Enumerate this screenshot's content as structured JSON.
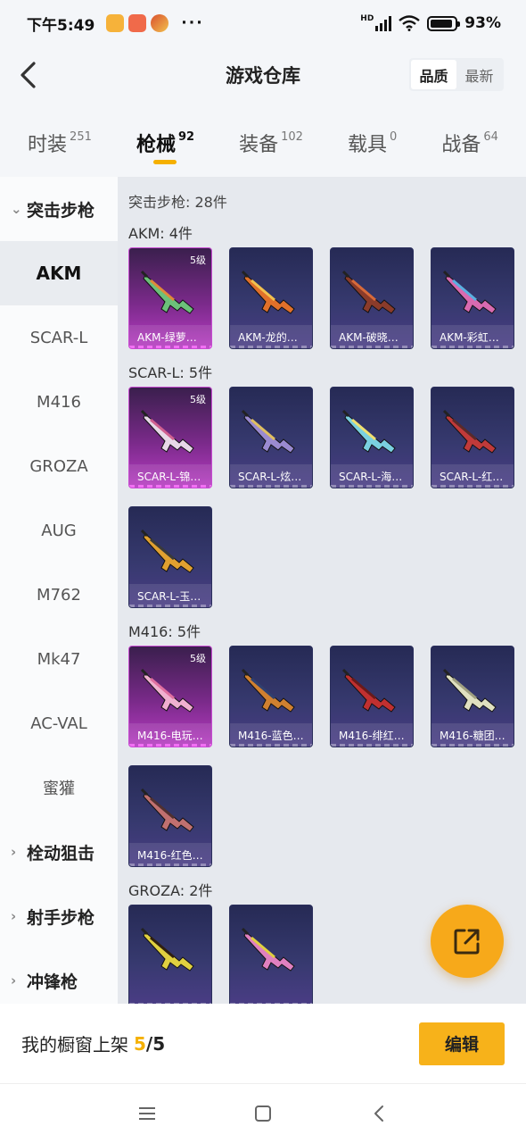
{
  "status_bar": {
    "time": "下午5:49",
    "hd": "HD",
    "battery": "93%",
    "more": "···"
  },
  "header": {
    "title": "游戏仓库",
    "sort_options": [
      "品质",
      "最新"
    ],
    "sort_selected": "品质"
  },
  "tabs": [
    {
      "label": "时装",
      "count": "251"
    },
    {
      "label": "枪械",
      "count": "92",
      "active": true
    },
    {
      "label": "装备",
      "count": "102"
    },
    {
      "label": "载具",
      "count": "0"
    },
    {
      "label": "战备",
      "count": "64"
    }
  ],
  "sidebar": {
    "groups": [
      {
        "label": "突击步枪",
        "expanded": true,
        "items": [
          "AKM",
          "SCAR-L",
          "M416",
          "GROZA",
          "AUG",
          "M762",
          "Mk47",
          "AC-VAL",
          "蜜獾"
        ]
      },
      {
        "label": "栓动狙击",
        "expanded": false
      },
      {
        "label": "射手步枪",
        "expanded": false
      },
      {
        "label": "冲锋枪",
        "expanded": false
      }
    ],
    "selected": "AKM"
  },
  "content": {
    "total": "突击步枪: 28件",
    "sections": [
      {
        "title": "AKM: 4件",
        "items": [
          {
            "name": "AKM-绿萝…",
            "level": "5级",
            "rarity": "epic"
          },
          {
            "name": "AKM-龙的…",
            "rarity": "normal"
          },
          {
            "name": "AKM-破晓…",
            "rarity": "normal"
          },
          {
            "name": "AKM-彩虹…",
            "rarity": "normal"
          }
        ]
      },
      {
        "title": "SCAR-L: 5件",
        "items": [
          {
            "name": "SCAR-L-锦…",
            "level": "5级",
            "rarity": "epic"
          },
          {
            "name": "SCAR-L-炫…",
            "rarity": "normal"
          },
          {
            "name": "SCAR-L-海…",
            "rarity": "normal"
          },
          {
            "name": "SCAR-L-红…",
            "rarity": "normal"
          },
          {
            "name": "SCAR-L-玉…",
            "rarity": "normal"
          }
        ]
      },
      {
        "title": "M416: 5件",
        "items": [
          {
            "name": "M416-电玩…",
            "level": "5级",
            "rarity": "epic"
          },
          {
            "name": "M416-蓝色…",
            "rarity": "normal"
          },
          {
            "name": "M416-绯红…",
            "rarity": "normal"
          },
          {
            "name": "M416-糖团…",
            "rarity": "normal"
          },
          {
            "name": "M416-红色…",
            "rarity": "normal"
          }
        ]
      },
      {
        "title": "GROZA: 2件",
        "items": [
          {
            "name": "",
            "rarity": "normal"
          },
          {
            "name": "",
            "rarity": "normal"
          }
        ]
      }
    ]
  },
  "showcase": {
    "label": "我的橱窗上架",
    "used": "5",
    "separator": "/",
    "total": "5",
    "edit_label": "编辑"
  },
  "icons": {
    "back": "back-arrow-icon",
    "share": "share-export-icon",
    "nav_menu": "menu-icon",
    "nav_home": "home-square-icon",
    "nav_back": "nav-back-icon"
  },
  "colors": {
    "accent": "#f5b000",
    "epic_card": "#b73cc2",
    "normal_card": "#36396e"
  }
}
